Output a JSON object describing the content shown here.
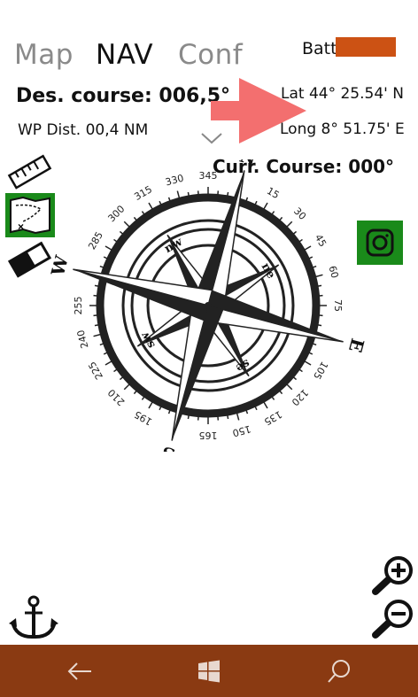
{
  "tabs": [
    {
      "label": "Map"
    },
    {
      "label": "NAV"
    },
    {
      "label": "Conf"
    }
  ],
  "battery": {
    "label": "Batt.",
    "level_fraction": 0.9,
    "color": "#cc5214"
  },
  "desired_course": "Des. course: 006,5°",
  "wp_distance": "WP Dist. 00,4 NM",
  "latitude": "Lat 44° 25.54' N",
  "longitude": "Long 8° 51.75' E",
  "current_course": "Curr. Course: 000°",
  "compass": {
    "cardinals": [
      "N",
      "E",
      "S",
      "W"
    ],
    "intercardinals": [
      "ne",
      "se",
      "sw",
      "nw"
    ],
    "degree_labels": [
      "15",
      "30",
      "45",
      "60",
      "75",
      "105",
      "120",
      "135",
      "150",
      "165",
      "195",
      "210",
      "225",
      "240",
      "255",
      "285",
      "300",
      "315",
      "330",
      "345"
    ]
  },
  "icons": {
    "ruler": "ruler-icon",
    "route_map": "route-map-icon",
    "eraser": "eraser-icon",
    "camera": "instagram-camera-icon",
    "zoom_in": "zoom-in-icon",
    "zoom_out": "zoom-out-icon",
    "anchor": "anchor-icon",
    "chevron": "chevron-down-icon",
    "arrow": "pointer-arrow-icon"
  },
  "colors": {
    "accent_green": "#1a8a1a",
    "nav_bar": "#8a3a12",
    "arrow": "#f36f6f"
  }
}
